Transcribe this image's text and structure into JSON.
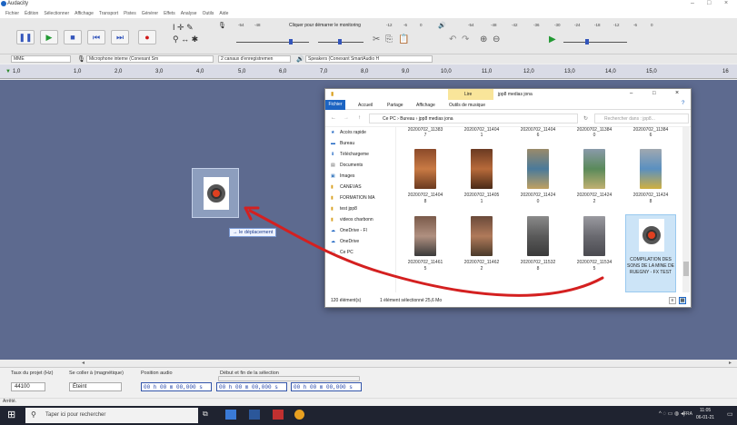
{
  "window": {
    "title": "Audacity"
  },
  "menu": [
    "Fichier",
    "Édition",
    "Sélectionner",
    "Affichage",
    "Transport",
    "Pistes",
    "Générer",
    "Effets",
    "Analyse",
    "Outils",
    "Aide"
  ],
  "meter": {
    "prompt": "Cliquer pour démarrer le monitoring",
    "scale": [
      "-54",
      "-48",
      "-42",
      "-36",
      "-30",
      "-24",
      "-18",
      "-12",
      "-6",
      "0"
    ],
    "rec_scale": [
      "-54",
      "-48",
      "-12",
      "-6",
      "0"
    ]
  },
  "devices": {
    "host": "MME",
    "mic": "Microphone interne (Conexant Sm",
    "channels": "2 canaux d'enregistremen",
    "speaker": "Speakers (Conexant SmartAudio H"
  },
  "ruler": [
    "1,0",
    "1,0",
    "2,0",
    "3,0",
    "4,0",
    "5,0",
    "6,0",
    "7,0",
    "8,0",
    "9,0",
    "10,0",
    "11,0",
    "12,0",
    "13,0",
    "14,0",
    "15,0",
    "16"
  ],
  "selection_bar": {
    "rate_label": "Taux du projet (Hz)",
    "snap_label": "Se coller à (magnétique)",
    "pos_label": "Position audio",
    "range_label": "Début et fin de la sélection",
    "rate_value": "44100",
    "snap_value": "Éteint",
    "pos_value": "00 h 00 m 00,000 s",
    "start_value": "00 h 00 m 00,000 s",
    "end_value": "00 h 00 m 00,000 s"
  },
  "status": "Arrêté.",
  "drag": {
    "tooltip": "→ le déplacement"
  },
  "explorer": {
    "title": "jpp8 medias jona",
    "lire_tab": "Lire",
    "ribbon": [
      "Fichier",
      "Accueil",
      "Partage",
      "Affichage",
      "Outils de musique"
    ],
    "breadcrumb": [
      "Ce PC",
      "Bureau",
      "jpp8 medias jona"
    ],
    "search_placeholder": "Rechercher dans : jpp8...",
    "nav": [
      "Accès rapide",
      "Bureau",
      "Téléchargeme",
      "Documents",
      "Images",
      "CANEVAS",
      "FORMATION MA",
      "test jpp8",
      "videos charbonn",
      "OneDrive - Fl",
      "OneDrive",
      "Ce PC"
    ],
    "files_row0": [
      "20200702_11383",
      "20200702_11404",
      "20200702_11404",
      "20200702_11384",
      "20200702_11384"
    ],
    "files_row0_sub": [
      "7",
      "1",
      "6",
      "0",
      "6"
    ],
    "files_row1": [
      "20200702_11404",
      "20200702_11405",
      "20200702_11424",
      "20200702_11424",
      "20200702_11424"
    ],
    "files_row1_sub": [
      "8",
      "1",
      "0",
      "2",
      "8"
    ],
    "files_row2": [
      "20200702_11461",
      "20200702_11462",
      "20200702_11532",
      "20200702_11534",
      "COMPILATION DES SONS DE LA MINE DE RUEGNY - FX TEST"
    ],
    "files_row2_sub": [
      "5",
      "2",
      "8",
      "5",
      ""
    ],
    "status_count": "120 élément(s)",
    "status_sel": "1 élément sélectionné  25,6 Mo"
  },
  "taskbar": {
    "search": "Taper ici pour rechercher",
    "time": "11:05",
    "date": "06-01-21",
    "lang": "FRA"
  },
  "colors": {
    "accent": "#1c64c2",
    "track_bg": "#5d6a8f",
    "arrow": "#d42020"
  }
}
